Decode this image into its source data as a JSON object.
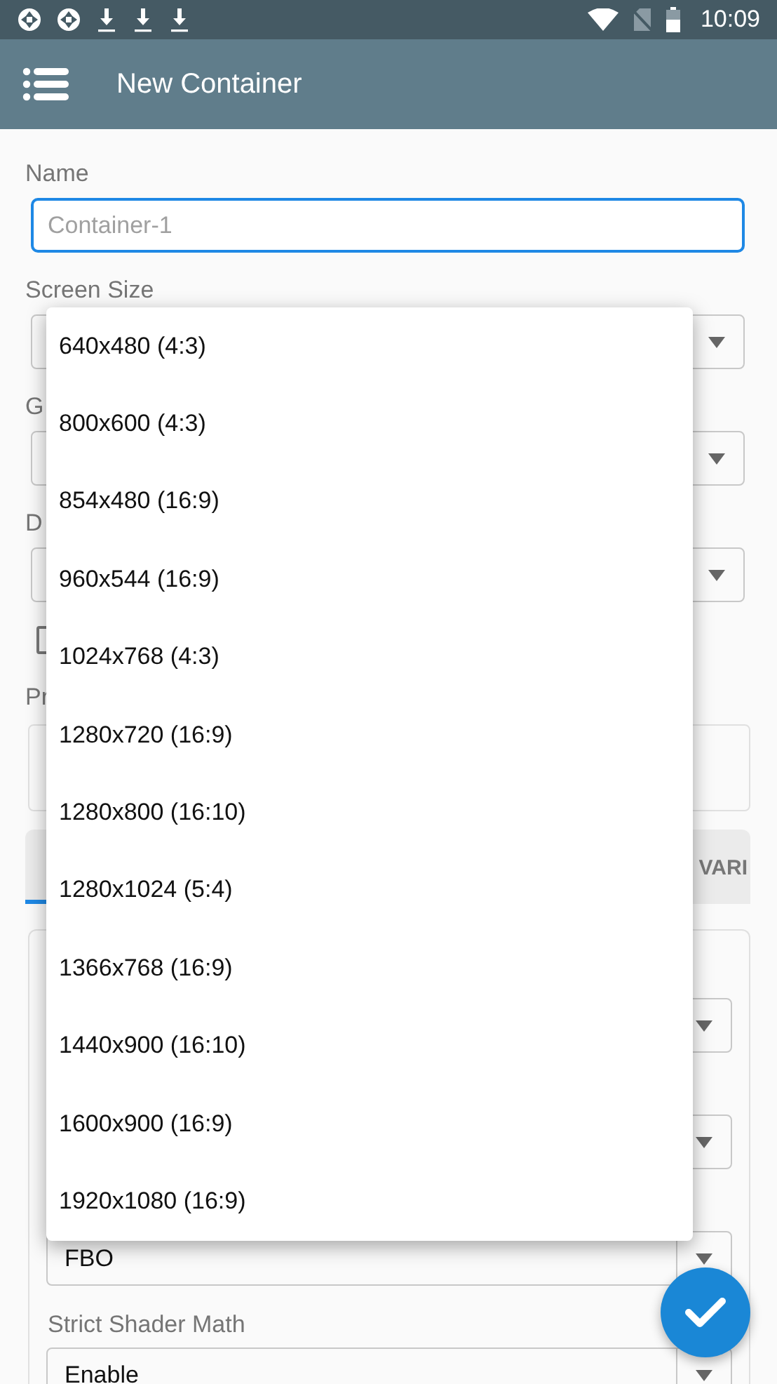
{
  "status_bar": {
    "time": "10:09"
  },
  "app_bar": {
    "title": "New Container"
  },
  "form": {
    "fields": [
      {
        "kind": "input",
        "label": "Name",
        "placeholder": "Container-1",
        "focused": true
      },
      {
        "kind": "select",
        "label": "Screen Size"
      },
      {
        "kind": "select",
        "label": "G"
      },
      {
        "kind": "select",
        "label": "D"
      },
      {
        "kind": "checkbox",
        "checked": false
      },
      {
        "kind": "textarea",
        "label": "Pr"
      }
    ],
    "tabs": [
      {
        "selected": true
      },
      {
        "label": "VARI",
        "selected": false
      }
    ],
    "panel": {
      "fields": [
        {
          "kind": "select"
        },
        {
          "kind": "select"
        },
        {
          "kind": "select",
          "value": "FBO"
        },
        {
          "kind": "select",
          "label": "Strict Shader Math",
          "value": "Enable"
        }
      ]
    }
  },
  "dropdown": {
    "options": [
      {
        "label": "640x480 (4:3)"
      },
      {
        "label": "800x600 (4:3)"
      },
      {
        "label": "854x480 (16:9)"
      },
      {
        "label": "960x544 (16:9)"
      },
      {
        "label": "1024x768 (4:3)"
      },
      {
        "label": "1280x720 (16:9)"
      },
      {
        "label": "1280x800 (16:10)"
      },
      {
        "label": "1280x1024 (5:4)"
      },
      {
        "label": "1366x768 (16:9)"
      },
      {
        "label": "1440x900 (16:10)"
      },
      {
        "label": "1600x900 (16:9)"
      },
      {
        "label": "1920x1080 (16:9)"
      }
    ]
  }
}
